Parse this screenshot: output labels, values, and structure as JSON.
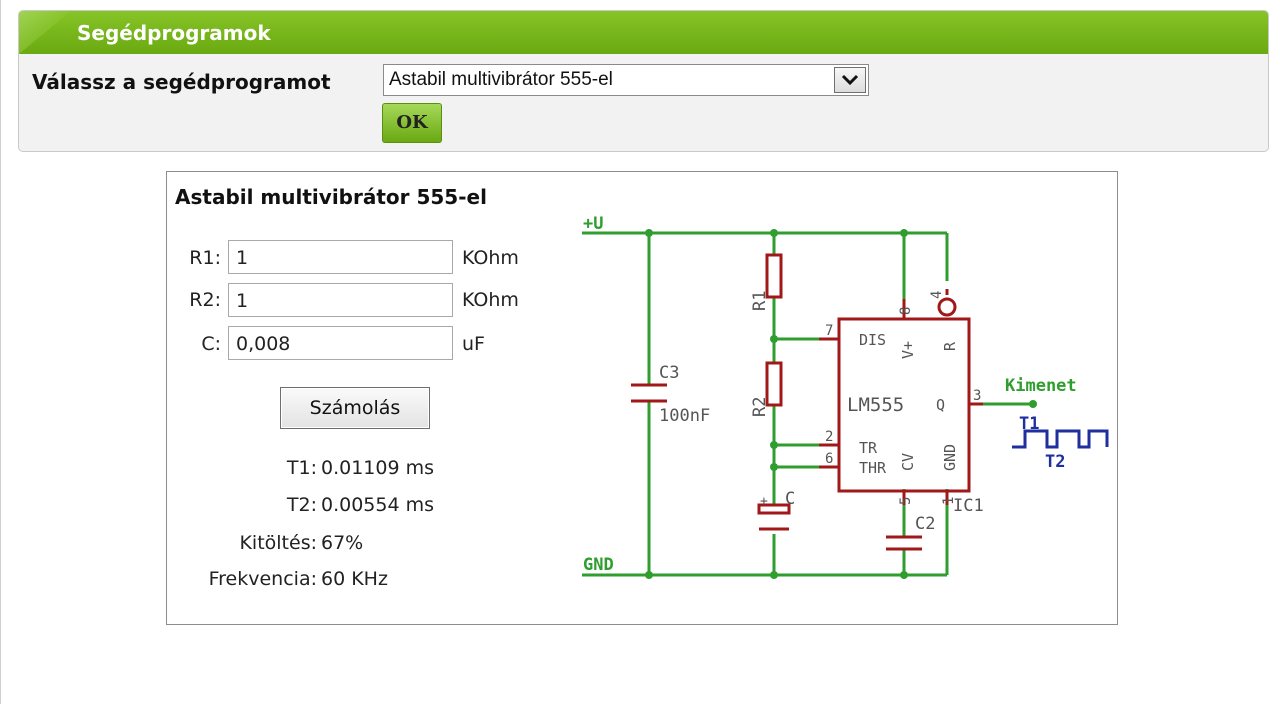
{
  "panel": {
    "title": "Segédprogramok",
    "select_label": "Válassz a segédprogramot",
    "selected_tool": "Astabil multivibrátor 555-el",
    "ok_label": "OK"
  },
  "calculator": {
    "title": "Astabil multivibrátor 555-el",
    "fields": [
      {
        "label": "R1:",
        "value": "1",
        "unit": "KOhm"
      },
      {
        "label": "R2:",
        "value": "1",
        "unit": "KOhm"
      },
      {
        "label": "C:",
        "value": "0,008",
        "unit": "uF"
      }
    ],
    "calc_button": "Számolás",
    "results": [
      {
        "label": "T1:",
        "value": "0.01109 ms"
      },
      {
        "label": "T2:",
        "value": "0.00554 ms"
      },
      {
        "label": "Kitöltés:",
        "value": "67%"
      },
      {
        "label": "Frekvencia:",
        "value": "60 KHz"
      }
    ]
  },
  "schematic": {
    "vcc": "+U",
    "gnd": "GND",
    "c3": "C3",
    "c3_value": "100nF",
    "r1": "R1",
    "r2": "R2",
    "c": "C",
    "c2": "C2",
    "ic": "IC1",
    "chip": "LM555",
    "pin_dis": "DIS",
    "pin_vplus": "V+",
    "pin_r": "R",
    "pin_q": "Q",
    "pin_tr": "TR",
    "pin_thr": "THR",
    "pin_cv": "CV",
    "pin_gnd": "GND",
    "pin7": "7",
    "pin8": "8",
    "pin4": "4",
    "pin3": "3",
    "pin2": "2",
    "pin6": "6",
    "pin5": "5",
    "pin1": "1",
    "plus": "+",
    "output": "Kimenet",
    "t1": "T1",
    "t2": "T2",
    "colors": {
      "wire": "#2f9e2f",
      "part": "#a01818",
      "label": "#555555",
      "wave": "#1f2f9f"
    }
  }
}
